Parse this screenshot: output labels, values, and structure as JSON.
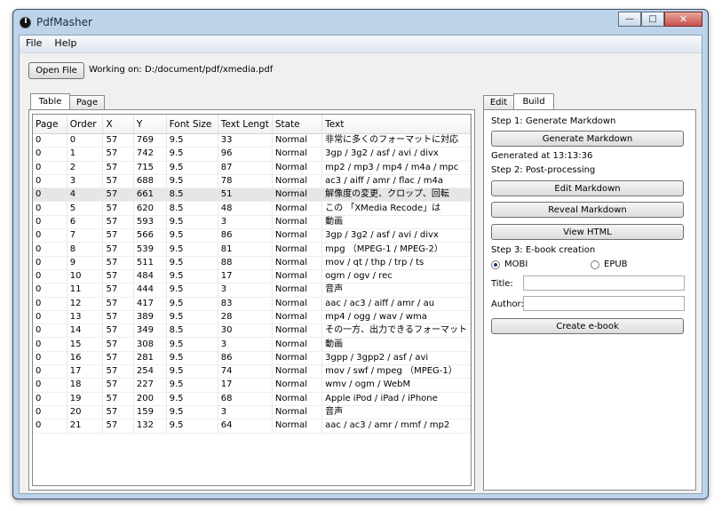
{
  "window": {
    "title": "PdfMasher",
    "min_icon": "—",
    "max_icon": "□",
    "close_icon": "✕"
  },
  "menu": {
    "items": [
      "File",
      "Help"
    ]
  },
  "toolbar": {
    "open_label": "Open File",
    "working_text": "Working on: D:/document/pdf/xmedia.pdf"
  },
  "left_tabs": [
    "Table",
    "Page"
  ],
  "table": {
    "columns": [
      "Page",
      "Order",
      "X",
      "Y",
      "Font Size",
      "Text Lengt",
      "State",
      "Text"
    ],
    "rows": [
      [
        "0",
        "0",
        "57",
        "769",
        "9.5",
        "33",
        "Normal",
        "非常に多くのフォーマットに対応"
      ],
      [
        "0",
        "1",
        "57",
        "742",
        "9.5",
        "96",
        "Normal",
        "3gp / 3g2 / asf / avi / divx"
      ],
      [
        "0",
        "2",
        "57",
        "715",
        "9.5",
        "87",
        "Normal",
        "mp2 / mp3 / mp4 / m4a / mpc"
      ],
      [
        "0",
        "3",
        "57",
        "688",
        "9.5",
        "78",
        "Normal",
        "ac3 / aiff / amr / flac / m4a"
      ],
      [
        "0",
        "4",
        "57",
        "661",
        "8.5",
        "51",
        "Normal",
        "解像度の変更、クロップ、回転"
      ],
      [
        "0",
        "5",
        "57",
        "620",
        "8.5",
        "48",
        "Normal",
        "この 「XMedia Recode」は"
      ],
      [
        "0",
        "6",
        "57",
        "593",
        "9.5",
        "3",
        "Normal",
        "動画"
      ],
      [
        "0",
        "7",
        "57",
        "566",
        "9.5",
        "86",
        "Normal",
        "3gp / 3g2 / asf / avi / divx"
      ],
      [
        "0",
        "8",
        "57",
        "539",
        "9.5",
        "81",
        "Normal",
        " mpg （MPEG-1 / MPEG-2）"
      ],
      [
        "0",
        "9",
        "57",
        "511",
        "9.5",
        "88",
        "Normal",
        " mov / qt / thp / trp / ts"
      ],
      [
        "0",
        "10",
        "57",
        "484",
        "9.5",
        "17",
        "Normal",
        " ogm / ogv / rec"
      ],
      [
        "0",
        "11",
        "57",
        "444",
        "9.5",
        "3",
        "Normal",
        "音声"
      ],
      [
        "0",
        "12",
        "57",
        "417",
        "9.5",
        "83",
        "Normal",
        "aac / ac3 / aiff / amr / au"
      ],
      [
        "0",
        "13",
        "57",
        "389",
        "9.5",
        "28",
        "Normal",
        " mp4 / ogg / wav / wma"
      ],
      [
        "0",
        "14",
        "57",
        "349",
        "8.5",
        "30",
        "Normal",
        "その一方、出力できるフォーマット"
      ],
      [
        "0",
        "15",
        "57",
        "308",
        "9.5",
        "3",
        "Normal",
        "動画"
      ],
      [
        "0",
        "16",
        "57",
        "281",
        "9.5",
        "86",
        "Normal",
        "3gpp / 3gpp2 / asf / avi"
      ],
      [
        "0",
        "17",
        "57",
        "254",
        "9.5",
        "74",
        "Normal",
        " mov / swf / mpeg （MPEG-1）"
      ],
      [
        "0",
        "18",
        "57",
        "227",
        "9.5",
        "17",
        "Normal",
        "wmv / ogm / WebM"
      ],
      [
        "0",
        "19",
        "57",
        "200",
        "9.5",
        "68",
        "Normal",
        "Apple iPod / iPad / iPhone"
      ],
      [
        "0",
        "20",
        "57",
        "159",
        "9.5",
        "3",
        "Normal",
        "音声"
      ],
      [
        "0",
        "21",
        "57",
        "132",
        "9.5",
        "64",
        "Normal",
        "aac / ac3 / amr / mmf / mp2"
      ]
    ]
  },
  "right_tabs": [
    "Edit",
    "Build"
  ],
  "build": {
    "step1": "Step 1: Generate Markdown",
    "generate_label": "Generate Markdown",
    "generated_at": "Generated at 13:13:36",
    "step2": "Step 2: Post-processing",
    "edit_label": "Edit Markdown",
    "reveal_label": "Reveal Markdown",
    "view_label": "View HTML",
    "step3": "Step 3: E-book creation",
    "mobi_label": "MOBI",
    "epub_label": "EPUB",
    "title_label": "Title:",
    "title_value": "",
    "author_label": "Author:",
    "author_value": "",
    "create_label": "Create e-book"
  }
}
